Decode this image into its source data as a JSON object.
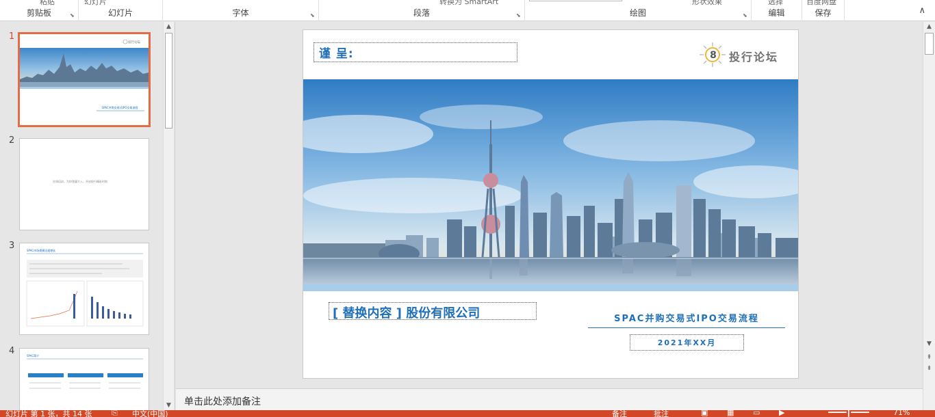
{
  "ribbon": {
    "groups": [
      {
        "label": "剪贴板",
        "cut": "粘贴"
      },
      {
        "label": "幻灯片",
        "cut": "幻灯片"
      },
      {
        "label": "字体",
        "cut": ""
      },
      {
        "label": "段落",
        "cut": "转换为 SmartArt"
      },
      {
        "label": "绘图",
        "cut": "形状效果"
      },
      {
        "label": "编辑",
        "cut": "选择"
      },
      {
        "label": "保存",
        "cut": "百度网盘"
      }
    ]
  },
  "thumbnails": [
    {
      "number": "1",
      "title": "SPAC并购交易式IPO交易流程",
      "logo": "投行论坛"
    },
    {
      "number": "2",
      "text": "在线培训、为你答疑介入，开启投行精彩时刻"
    },
    {
      "number": "3",
      "title": "SPAC市场规模迅速增长"
    },
    {
      "number": "4",
      "title": "SPAC简介"
    }
  ],
  "slide": {
    "addressee": "谨 呈:",
    "logo_text": "投行论坛",
    "logo_badge": "8",
    "company": "[ 替换内容 ] 股份有限公司",
    "subtitle": "SPAC并购交易式IPO交易流程",
    "date": "2021年XX月"
  },
  "notes": {
    "placeholder": "单击此处添加备注"
  },
  "status": {
    "slide_info": "幻灯片 第 1 张，共 14 张",
    "language": "中文(中国)",
    "notes_btn": "备注",
    "comments_btn": "批注",
    "zoom": "71%"
  },
  "colors": {
    "accent": "#d24726",
    "title_blue": "#1f6fb8",
    "selection": "#e46c44"
  }
}
